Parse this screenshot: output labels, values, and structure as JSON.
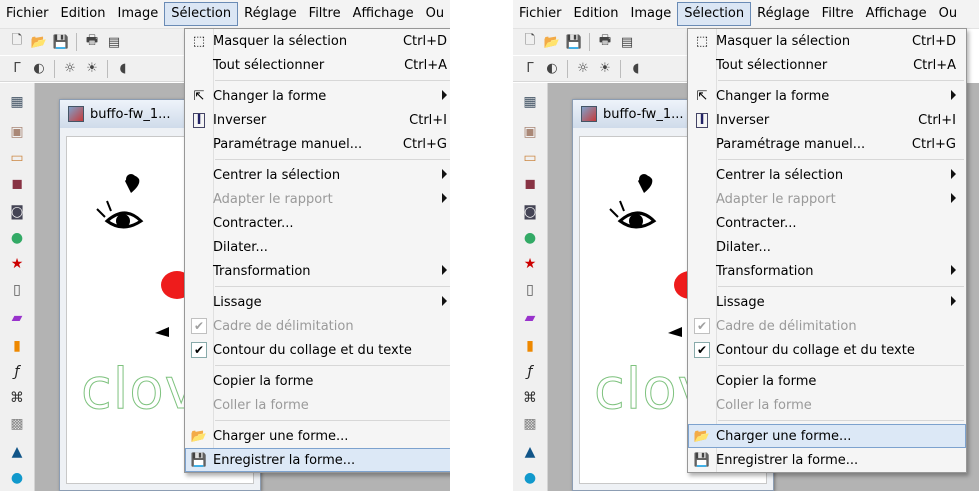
{
  "menubar": [
    "Fichier",
    "Edition",
    "Image",
    "Sélection",
    "Réglage",
    "Filtre",
    "Affichage",
    "Ou"
  ],
  "document_title": "buffo-fw_1...",
  "canvas_text": "clov",
  "menu": {
    "masquer": {
      "label": "Masquer la sélection",
      "shortcut": "Ctrl+D"
    },
    "tout": {
      "label": "Tout sélectionner",
      "shortcut": "Ctrl+A"
    },
    "changer": {
      "label": "Changer la forme"
    },
    "inverser": {
      "label": "Inverser",
      "shortcut": "Ctrl+I"
    },
    "parametrage": {
      "label": "Paramétrage manuel...",
      "shortcut": "Ctrl+G"
    },
    "centrer": {
      "label": "Centrer la sélection"
    },
    "adapter": {
      "label": "Adapter le rapport"
    },
    "contracter": {
      "label": "Contracter..."
    },
    "dilater": {
      "label": "Dilater..."
    },
    "transformation": {
      "label": "Transformation"
    },
    "lissage": {
      "label": "Lissage"
    },
    "cadre": {
      "label": "Cadre de délimitation"
    },
    "contour": {
      "label": "Contour du collage et du texte"
    },
    "copier": {
      "label": "Copier la forme"
    },
    "coller": {
      "label": "Coller la forme"
    },
    "charger": {
      "label": "Charger une forme..."
    },
    "enregistrer": {
      "label": "Enregistrer la forme..."
    }
  },
  "highlighted_left": "Enregistrer la forme...",
  "highlighted_right": "Charger une forme..."
}
